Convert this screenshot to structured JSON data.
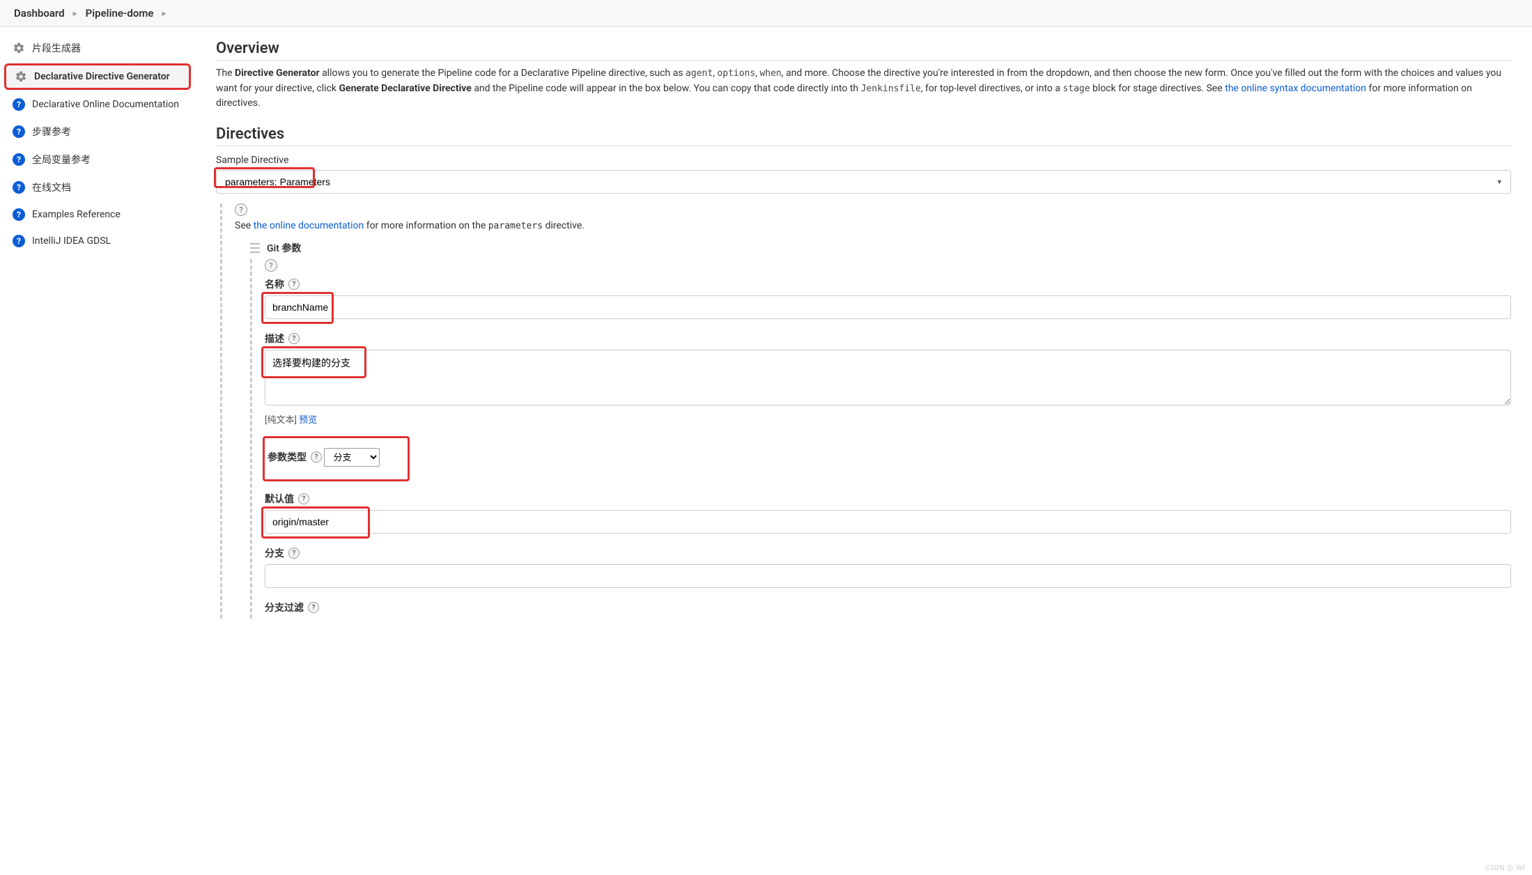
{
  "breadcrumb": {
    "items": [
      "Dashboard",
      "Pipeline-dome"
    ]
  },
  "sidebar": {
    "items": [
      {
        "label": "片段生成器",
        "icon": "gear"
      },
      {
        "label": "Declarative Directive Generator",
        "icon": "gear",
        "active": true
      },
      {
        "label": "Declarative Online Documentation",
        "icon": "help"
      },
      {
        "label": "步骤参考",
        "icon": "help"
      },
      {
        "label": "全局变量参考",
        "icon": "help"
      },
      {
        "label": "在线文档",
        "icon": "help"
      },
      {
        "label": "Examples Reference",
        "icon": "help"
      },
      {
        "label": "IntelliJ IDEA GDSL",
        "icon": "help"
      }
    ]
  },
  "overview": {
    "title": "Overview",
    "text_pre": "The ",
    "bold1": "Directive Generator",
    "text_mid1": " allows you to generate the Pipeline code for a Declarative Pipeline directive, such as ",
    "code_list": "agent, options, when",
    "text_mid1b": ", and more. Choose the directive you're interested in from the dropdown, and then choose the new form. Once you've filled out the form with the choices and values you want for your directive, click ",
    "bold2": "Generate Declarative Directive",
    "text_mid2": " and the Pipeline code will appear in the box below. You can copy that code directly into th ",
    "code1": "Jenkinsfile",
    "text_mid3": ", for top-level directives, or into a ",
    "code2": "stage",
    "text_mid4": " block for stage directives. See ",
    "link": "the online syntax documentation",
    "text_end": " for more information on directives."
  },
  "directives": {
    "title": "Directives",
    "sample_label": "Sample Directive",
    "sample_value": "parameters: Parameters",
    "see_pre": "See ",
    "see_link": "the online documentation",
    "see_mid": " for more information on the ",
    "see_code": "parameters",
    "see_end": " directive.",
    "git_param_title": "Git 参数",
    "fields": {
      "name": {
        "label": "名称",
        "value": "branchName"
      },
      "desc": {
        "label": "描述",
        "value": "选择要构建的分支",
        "hint_pre": "[纯文本] ",
        "hint_link": "预览"
      },
      "type": {
        "label": "参数类型",
        "value": "分支"
      },
      "default": {
        "label": "默认值",
        "value": "origin/master"
      },
      "branch": {
        "label": "分支",
        "value": ""
      },
      "branch_filter": {
        "label": "分支过滤",
        "value": ""
      }
    }
  },
  "watermark": "CSDN @ WF"
}
